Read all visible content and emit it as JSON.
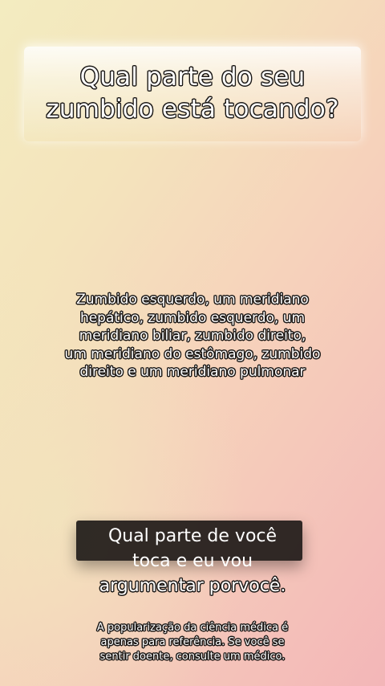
{
  "title": {
    "line1": "Qual parte do seu",
    "line2": "zumbido está tocando?"
  },
  "body": {
    "lines": [
      "Zumbido esquerdo, um meridiano",
      "hepático, zumbido esquerdo, um",
      "meridiano biliar, zumbido direito,",
      "um meridiano do estômago, zumbido",
      "direito e um meridiano pulmonar"
    ]
  },
  "caption": {
    "line1": "Qual parte de você",
    "line2": "toca e eu vou",
    "line3": "argumentar porvocê."
  },
  "disclaimer": {
    "lines": [
      "A popularização da ciência médica é",
      "apenas para referência. Se você se",
      "sentir doente, consulte um médico."
    ]
  },
  "colors": {
    "background_left": "#f3ecc0",
    "background_right": "#f3b6b8",
    "outline": "#1d1a18",
    "caption_box": "#1e1a18"
  }
}
